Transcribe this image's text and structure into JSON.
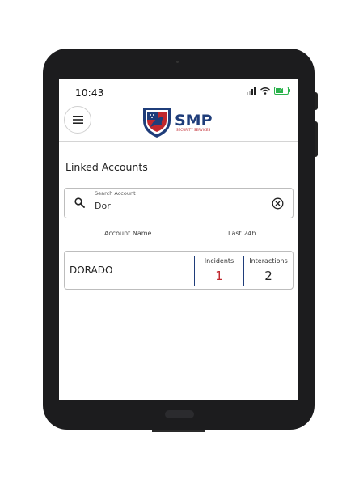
{
  "status_bar": {
    "time": "10:43"
  },
  "header": {
    "logo": {
      "title": "SMP",
      "subtitle": "SECURITY SERVICES"
    },
    "menu_icon": "hamburger-menu-icon"
  },
  "page": {
    "title": "Linked Accounts"
  },
  "search": {
    "label": "Search Account",
    "value": "Dor"
  },
  "columns": {
    "account_name": "Account Name",
    "last_24h": "Last 24h"
  },
  "accounts": [
    {
      "name": "DORADO",
      "incidents_label": "Incidents",
      "incidents": "1",
      "interactions_label": "Interactions",
      "interactions": "2"
    }
  ],
  "colors": {
    "accent_navy": "#1f3d7a",
    "incident_red": "#c0272d",
    "battery_green": "#2bb24c"
  },
  "battery": {
    "level": 0.75,
    "charging": true
  }
}
